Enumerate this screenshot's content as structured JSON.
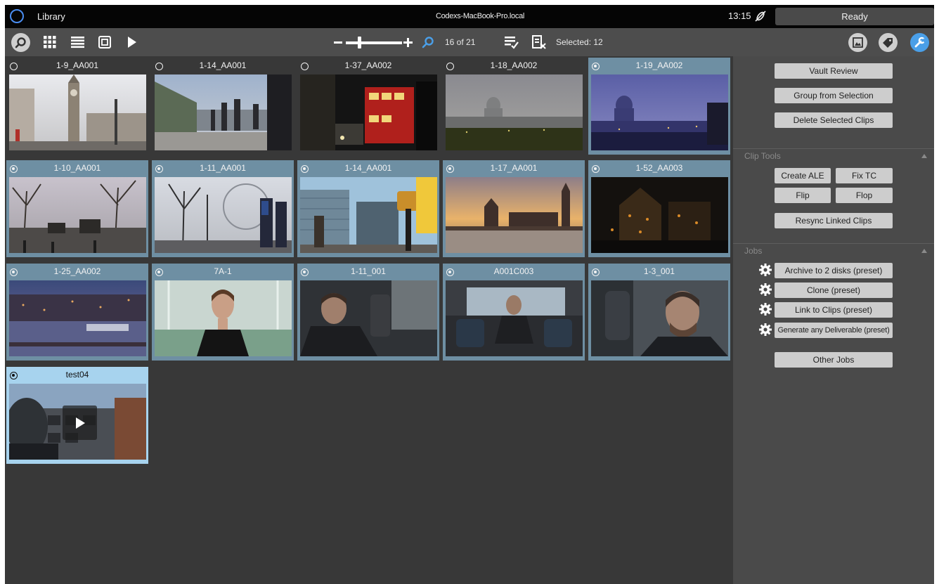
{
  "titlebar": {
    "app_title": "Library",
    "host": "Codexs-MacBook-Pro.local",
    "time": "13:15",
    "status": "Ready"
  },
  "toolbar": {
    "clip_count": "16 of 21",
    "selected_label": "Selected: 12",
    "icons": [
      "search-icon",
      "grid-view-icon",
      "list-view-icon",
      "single-view-icon",
      "play-icon",
      "zoom-out-icon",
      "zoom-in-icon",
      "search-icon",
      "select-all-icon",
      "deselect-icon",
      "image-icon",
      "tag-icon",
      "wrench-icon"
    ]
  },
  "clips": [
    {
      "name": "1-9_AA001",
      "state": "unsel"
    },
    {
      "name": "1-14_AA001",
      "state": "unsel"
    },
    {
      "name": "1-37_AA002",
      "state": "unsel"
    },
    {
      "name": "1-18_AA002",
      "state": "unsel"
    },
    {
      "name": "1-19_AA002",
      "state": "sel"
    },
    {
      "name": "1-10_AA001",
      "state": "sel"
    },
    {
      "name": "1-11_AA001",
      "state": "sel"
    },
    {
      "name": "1-14_AA001",
      "state": "sel"
    },
    {
      "name": "1-17_AA001",
      "state": "sel"
    },
    {
      "name": "1-52_AA003",
      "state": "sel"
    },
    {
      "name": "1-25_AA002",
      "state": "sel"
    },
    {
      "name": "7A-1",
      "state": "sel"
    },
    {
      "name": "1-11_001",
      "state": "sel"
    },
    {
      "name": "A001C003",
      "state": "sel"
    },
    {
      "name": "1-3_001",
      "state": "sel"
    },
    {
      "name": "test04",
      "state": "active"
    }
  ],
  "panel": {
    "top_buttons": {
      "vault_review": "Vault Review",
      "group_from_selection": "Group from Selection",
      "delete_selected": "Delete Selected Clips"
    },
    "clip_tools": {
      "title": "Clip Tools",
      "create_ale": "Create ALE",
      "fix_tc": "Fix TC",
      "flip": "Flip",
      "flop": "Flop",
      "resync": "Resync Linked Clips"
    },
    "jobs": {
      "title": "Jobs",
      "items": [
        "Archive to 2 disks (preset)",
        "Clone (preset)",
        "Link to Clips (preset)",
        "Generate any Deliverable (preset)"
      ],
      "other_jobs": "Other Jobs"
    }
  },
  "colors": {
    "selected_tile": "#6e8fa3",
    "active_tile": "#a7d3ee",
    "accent_blue": "#4a8df0"
  }
}
